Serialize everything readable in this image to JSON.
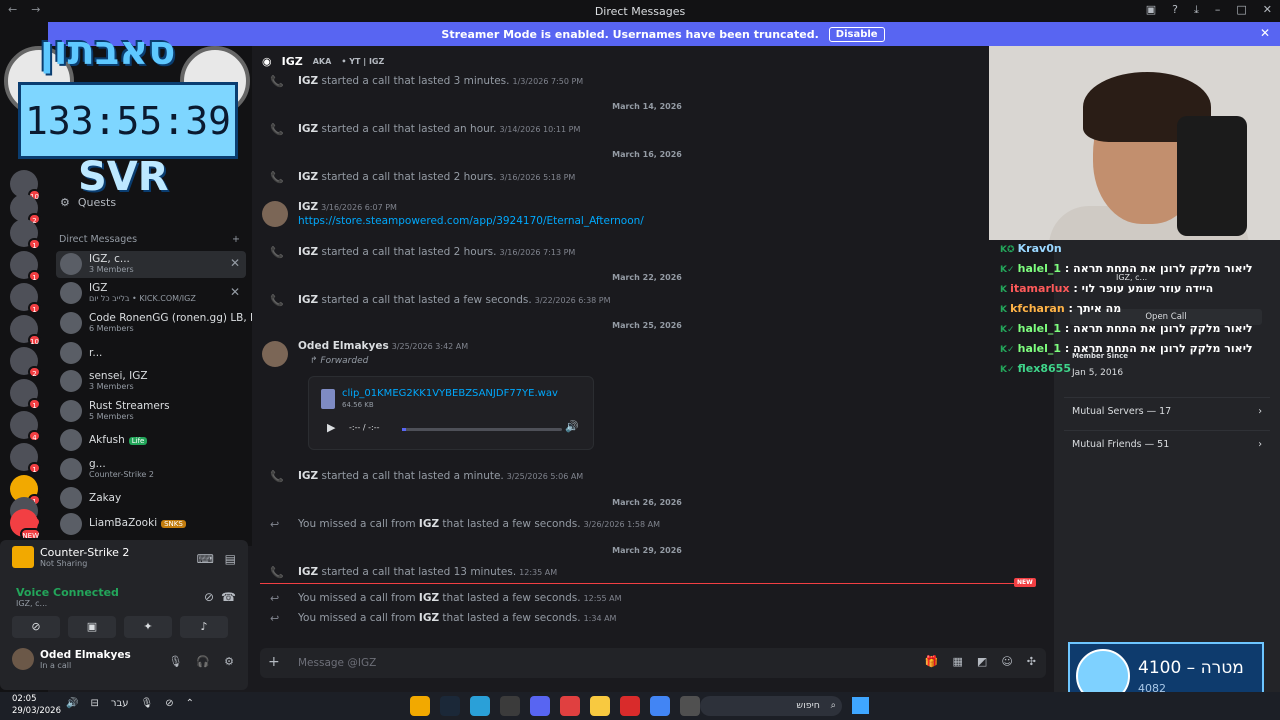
{
  "window": {
    "title": "Direct Messages"
  },
  "banner": {
    "text": "Streamer Mode is enabled. Usernames have been truncated.",
    "disable": "Disable"
  },
  "overlay": {
    "logo": "סאבתון",
    "timer": "133:55:39",
    "tag": "SVR"
  },
  "servers": [
    {
      "badge": "10"
    },
    {
      "badge": "2"
    },
    {
      "badge": "1"
    },
    {
      "badge": "1"
    },
    {
      "badge": "1"
    },
    {
      "badge": "10"
    },
    {
      "badge": "2"
    },
    {
      "badge": "1"
    },
    {
      "badge": "4"
    },
    {
      "badge": "1"
    },
    {
      "badge": "1"
    },
    {
      "badge": "1"
    },
    {
      "badge": "NEW"
    }
  ],
  "sidebar": {
    "quests": "Quests",
    "dm_header": "Direct Messages",
    "items": [
      {
        "name": "IGZ, c...",
        "sub": "3 Members",
        "close": true
      },
      {
        "name": "IGZ",
        "sub": "בלייב כל יום • KICK.COM/IGZ",
        "close": true
      },
      {
        "name": "Code RonenGG (ronen.gg) LB, I...",
        "sub": "6 Members"
      },
      {
        "name": "r...",
        "sub": ""
      },
      {
        "name": "sensei, IGZ",
        "sub": "3 Members"
      },
      {
        "name": "Rust Streamers",
        "sub": "5 Members"
      },
      {
        "name": "Akfush",
        "sub": "",
        "tag": "Life"
      },
      {
        "name": "g...",
        "sub": "Counter-Strike 2"
      },
      {
        "name": "Zakay",
        "sub": ""
      },
      {
        "name": "LiamBaZooki",
        "sub": "",
        "tag": "SNKS"
      }
    ]
  },
  "panel": {
    "game": "Counter-Strike 2",
    "game_sub": "Not Sharing",
    "voice": "Voice Connected",
    "voice_sub": "IGZ, c...",
    "user": "Oded Elmakyes",
    "user_status": "In a call"
  },
  "chat": {
    "header": "IGZ",
    "aka_label": "AKA",
    "aka": "• YT | IGZ",
    "placeholder": "Message @IGZ",
    "new_tag": "NEW",
    "messages": [
      {
        "kind": "call",
        "who": "IGZ",
        "text": "started a call that lasted 3 minutes.",
        "ts": "1/3/2026 7:50 PM"
      },
      {
        "kind": "divider",
        "text": "March 14, 2026"
      },
      {
        "kind": "call",
        "who": "IGZ",
        "text": "started a call that lasted an hour.",
        "ts": "3/14/2026 10:11 PM"
      },
      {
        "kind": "divider",
        "text": "March 16, 2026"
      },
      {
        "kind": "call",
        "who": "IGZ",
        "text": "started a call that lasted 2 hours.",
        "ts": "3/16/2026 5:18 PM"
      },
      {
        "kind": "post",
        "who": "IGZ",
        "ts": "3/16/2026 6:07 PM",
        "text": "https://store.steampowered.com/app/3924170/Eternal_Afternoon/"
      },
      {
        "kind": "call",
        "who": "IGZ",
        "text": "started a call that lasted 2 hours.",
        "ts": "3/16/2026 7:13 PM"
      },
      {
        "kind": "divider",
        "text": "March 22, 2026"
      },
      {
        "kind": "call",
        "who": "IGZ",
        "text": "started a call that lasted a few seconds.",
        "ts": "3/22/2026 6:38 PM"
      },
      {
        "kind": "divider",
        "text": "March 25, 2026"
      },
      {
        "kind": "post",
        "who": "Oded Elmakyes",
        "ts": "3/25/2026 3:42 AM",
        "text": "Forwarded"
      },
      {
        "kind": "call",
        "who": "IGZ",
        "text": "started a call that lasted a minute.",
        "ts": "3/25/2026 5:06 AM"
      },
      {
        "kind": "divider",
        "text": "March 26, 2026"
      },
      {
        "kind": "missed",
        "pre": "You missed a call from",
        "who": "IGZ",
        "text": "that lasted a few seconds.",
        "ts": "3/26/2026 1:58 AM"
      },
      {
        "kind": "divider",
        "text": "March 29, 2026"
      },
      {
        "kind": "call",
        "who": "IGZ",
        "text": "started a call that lasted 13 minutes.",
        "ts": "12:35 AM"
      },
      {
        "kind": "missed",
        "pre": "You missed a call from",
        "who": "IGZ",
        "text": "that lasted a few seconds.",
        "ts": "12:55 AM"
      },
      {
        "kind": "missed",
        "pre": "You missed a call from",
        "who": "IGZ",
        "text": "that lasted a few seconds.",
        "ts": "1:34 AM"
      }
    ],
    "attachment": {
      "name": "clip_01KMEG2KK1VYBEBZSANJDF77YE.wav",
      "size": "64.56 KB",
      "time": "-:-- / -:--"
    }
  },
  "stream_chat": [
    {
      "user": "Krav0n",
      "text": ""
    },
    {
      "user": "halel_1",
      "text": "ליאור מלקק לרונן את התחת תראה"
    },
    {
      "user": "itamarlux",
      "text": "היידה עוזר שומע עופר לוי"
    },
    {
      "user": "kfcharan",
      "text": "מה איתך"
    },
    {
      "user": "halel_1",
      "text": "ליאור מלקק לרונן את התחת תראה"
    },
    {
      "user": "halel_1",
      "text": "ליאור מלקק לרונן את התחת תראה"
    },
    {
      "user": "flex8655",
      "text": ""
    }
  ],
  "profile": {
    "name_small": "IGZ, c...",
    "open_call": "Open Call",
    "member_since": "Member Since",
    "member_since_val": "Jan 5, 2016",
    "mutual_servers": "Mutual Servers — 17",
    "mutual_friends": "Mutual Friends — 51"
  },
  "goal": {
    "line1": "4100 – מטרה",
    "line2": "4082"
  },
  "taskbar": {
    "time": "02:05",
    "date": "29/03/2026",
    "lang": "עבר",
    "search": "חיפוש"
  }
}
